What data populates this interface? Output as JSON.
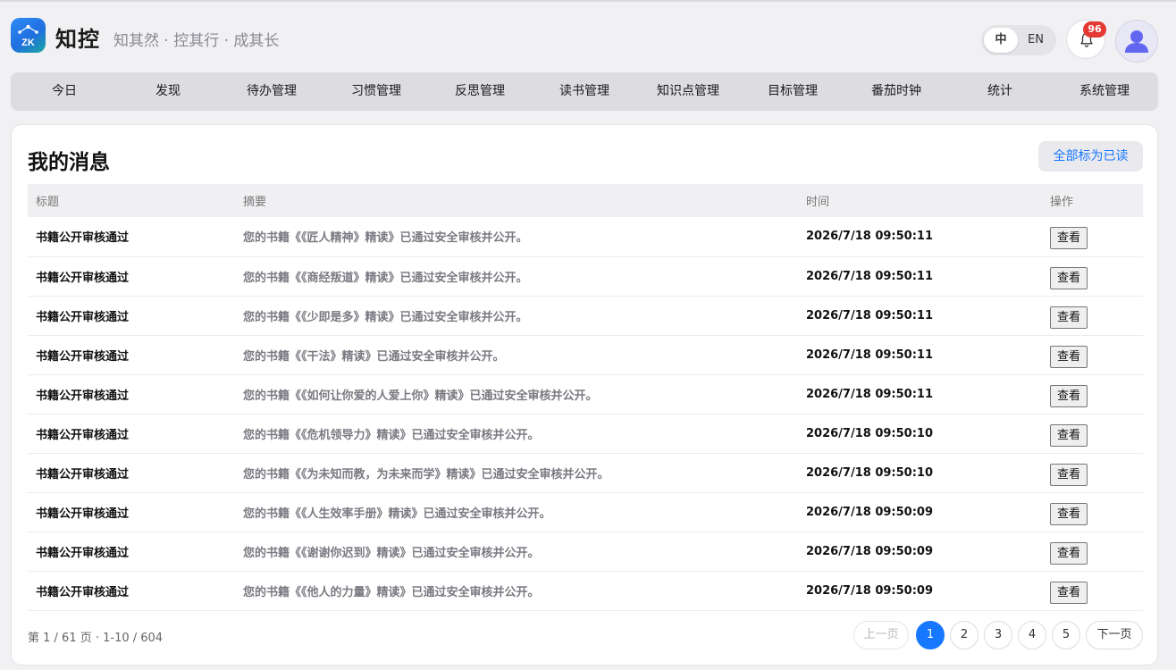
{
  "header": {
    "logo_text": "ZK",
    "brand_name": "知控",
    "slogan": "知其然 · 控其行 · 成其长",
    "lang": {
      "zh": "中",
      "en": "EN",
      "selected": "中"
    },
    "notification_count": "96"
  },
  "nav": {
    "items": [
      "今日",
      "发现",
      "待办管理",
      "习惯管理",
      "反思管理",
      "读书管理",
      "知识点管理",
      "目标管理",
      "番茄时钟",
      "统计",
      "系统管理"
    ]
  },
  "main": {
    "title": "我的消息",
    "mark_all_label": "全部标为已读",
    "columns": [
      "标题",
      "摘要",
      "时间",
      "操作"
    ],
    "view_label": "查看",
    "rows": [
      {
        "title": "书籍公开审核通过",
        "summary": "您的书籍《《匠人精神》精读》已通过安全审核并公开。",
        "time": "2026/7/18 09:50:11"
      },
      {
        "title": "书籍公开审核通过",
        "summary": "您的书籍《《商经叛道》精读》已通过安全审核并公开。",
        "time": "2026/7/18 09:50:11"
      },
      {
        "title": "书籍公开审核通过",
        "summary": "您的书籍《《少即是多》精读》已通过安全审核并公开。",
        "time": "2026/7/18 09:50:11"
      },
      {
        "title": "书籍公开审核通过",
        "summary": "您的书籍《《干法》精读》已通过安全审核并公开。",
        "time": "2026/7/18 09:50:11"
      },
      {
        "title": "书籍公开审核通过",
        "summary": "您的书籍《《如何让你爱的人爱上你》精读》已通过安全审核并公开。",
        "time": "2026/7/18 09:50:11"
      },
      {
        "title": "书籍公开审核通过",
        "summary": "您的书籍《《危机领导力》精读》已通过安全审核并公开。",
        "time": "2026/7/18 09:50:10"
      },
      {
        "title": "书籍公开审核通过",
        "summary": "您的书籍《《为未知而教，为未来而学》精读》已通过安全审核并公开。",
        "time": "2026/7/18 09:50:10"
      },
      {
        "title": "书籍公开审核通过",
        "summary": "您的书籍《《人生效率手册》精读》已通过安全审核并公开。",
        "time": "2026/7/18 09:50:09"
      },
      {
        "title": "书籍公开审核通过",
        "summary": "您的书籍《《谢谢你迟到》精读》已通过安全审核并公开。",
        "time": "2026/7/18 09:50:09"
      },
      {
        "title": "书籍公开审核通过",
        "summary": "您的书籍《《他人的力量》精读》已通过安全审核并公开。",
        "time": "2026/7/18 09:50:09"
      }
    ],
    "pagination": {
      "info": "第 1 / 61 页 · 1-10 / 604",
      "prev_label": "上一页",
      "next_label": "下一页",
      "pages": [
        "1",
        "2",
        "3",
        "4",
        "5"
      ],
      "current": "1"
    }
  },
  "colors": {
    "accent": "#1677ff",
    "badge": "#e53935",
    "background": "#f1f1f4"
  }
}
